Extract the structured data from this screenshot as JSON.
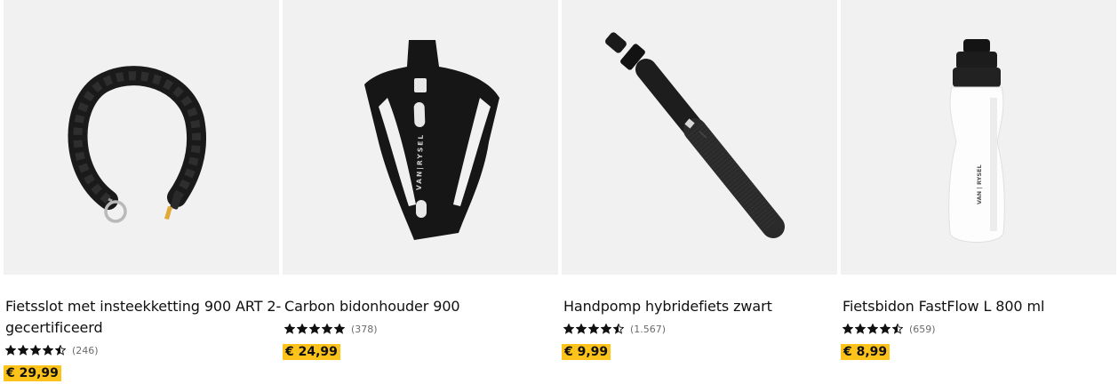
{
  "products": [
    {
      "title": "Fietsslot met insteekketting 900 ART 2-gecertificeerd",
      "rating": 4.5,
      "review_count": "(246)",
      "price": "€ 29,99",
      "image_icon": "chain-lock-icon"
    },
    {
      "title": "Carbon bidonhouder 900",
      "rating": 5,
      "review_count": "(378)",
      "price": "€ 24,99",
      "image_icon": "bottle-cage-icon",
      "image_brand": "VAN|RYSEL"
    },
    {
      "title": "Handpomp hybridefiets zwart",
      "rating": 4.5,
      "review_count": "(1.567)",
      "price": "€ 9,99",
      "image_icon": "hand-pump-icon"
    },
    {
      "title": "Fietsbidon FastFlow L 800 ml",
      "rating": 4.5,
      "review_count": "(659)",
      "price": "€ 8,99",
      "image_icon": "water-bottle-icon",
      "image_brand": "VAN | RYSEL"
    }
  ],
  "colors": {
    "price_badge": "#fec31b",
    "image_background": "#f1f1f1",
    "star": "#101010"
  }
}
